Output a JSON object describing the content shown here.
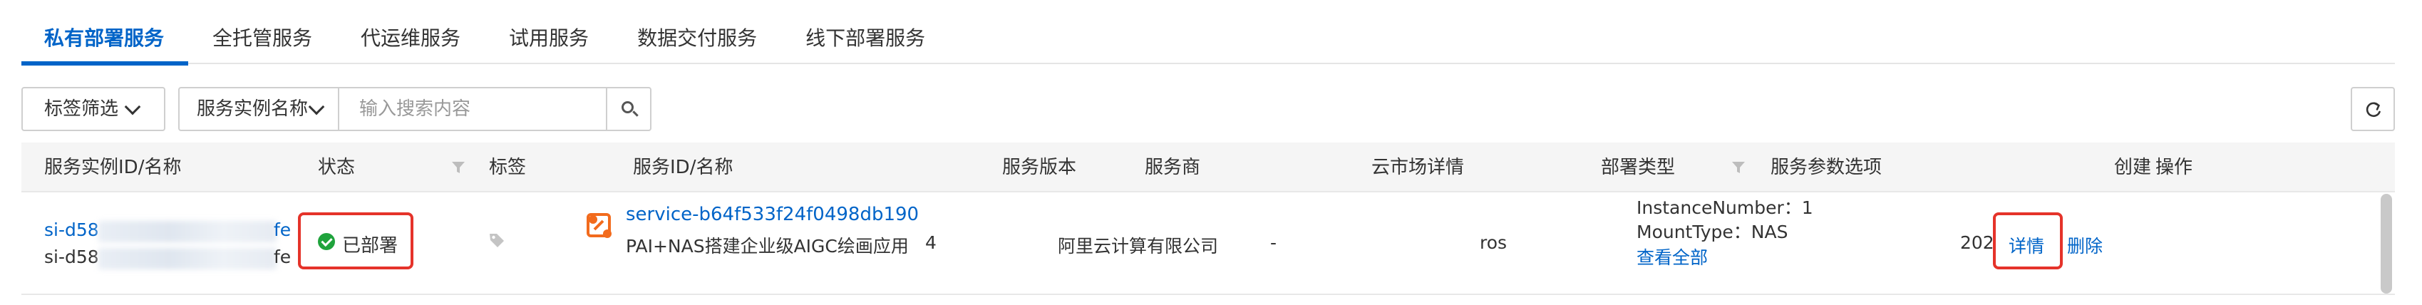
{
  "tabs": [
    {
      "label": "私有部署服务",
      "active": true
    },
    {
      "label": "全托管服务",
      "active": false
    },
    {
      "label": "代运维服务",
      "active": false
    },
    {
      "label": "试用服务",
      "active": false
    },
    {
      "label": "数据交付服务",
      "active": false
    },
    {
      "label": "线下部署服务",
      "active": false
    }
  ],
  "toolbar": {
    "tag_filter_label": "标签筛选",
    "search_field_label": "服务实例名称",
    "search_placeholder": "输入搜索内容",
    "search_value": ""
  },
  "table": {
    "headers": {
      "instance": "服务实例ID/名称",
      "status": "状态",
      "tags": "标签",
      "service": "服务ID/名称",
      "version": "服务版本",
      "provider": "服务商",
      "marketplace": "云市场详情",
      "deploy_type": "部署类型",
      "params": "服务参数选项",
      "created": "创建",
      "actions": "操作"
    },
    "rows": [
      {
        "instance_id_prefix": "si-d58",
        "instance_id_suffix": "fe",
        "instance_name_prefix": "si-d58",
        "instance_name_suffix": "fe",
        "status": "已部署",
        "service_id": "service-b64f533f24f0498db190",
        "service_name": "PAI+NAS搭建企业级AIGC绘画应用",
        "version": "4",
        "provider": "阿里云计算有限公司",
        "marketplace": "-",
        "deploy_type": "ros",
        "params": [
          "InstanceNumber：1",
          "MountType：NAS"
        ],
        "params_more": "查看全部",
        "created": "202",
        "action_detail": "详情",
        "action_delete": "删除"
      }
    ]
  },
  "colors": {
    "accent": "#0064c8",
    "status_ok": "#1fa33c",
    "highlight_box": "#e5332a",
    "service_icon": "#f26b1d"
  },
  "icons": {
    "tag_filter": "chevron-down-icon",
    "search": "search-icon",
    "refresh": "refresh-icon",
    "filter": "filter-icon",
    "tag": "tag-icon",
    "service": "service-icon",
    "status": "check-circle-icon"
  }
}
